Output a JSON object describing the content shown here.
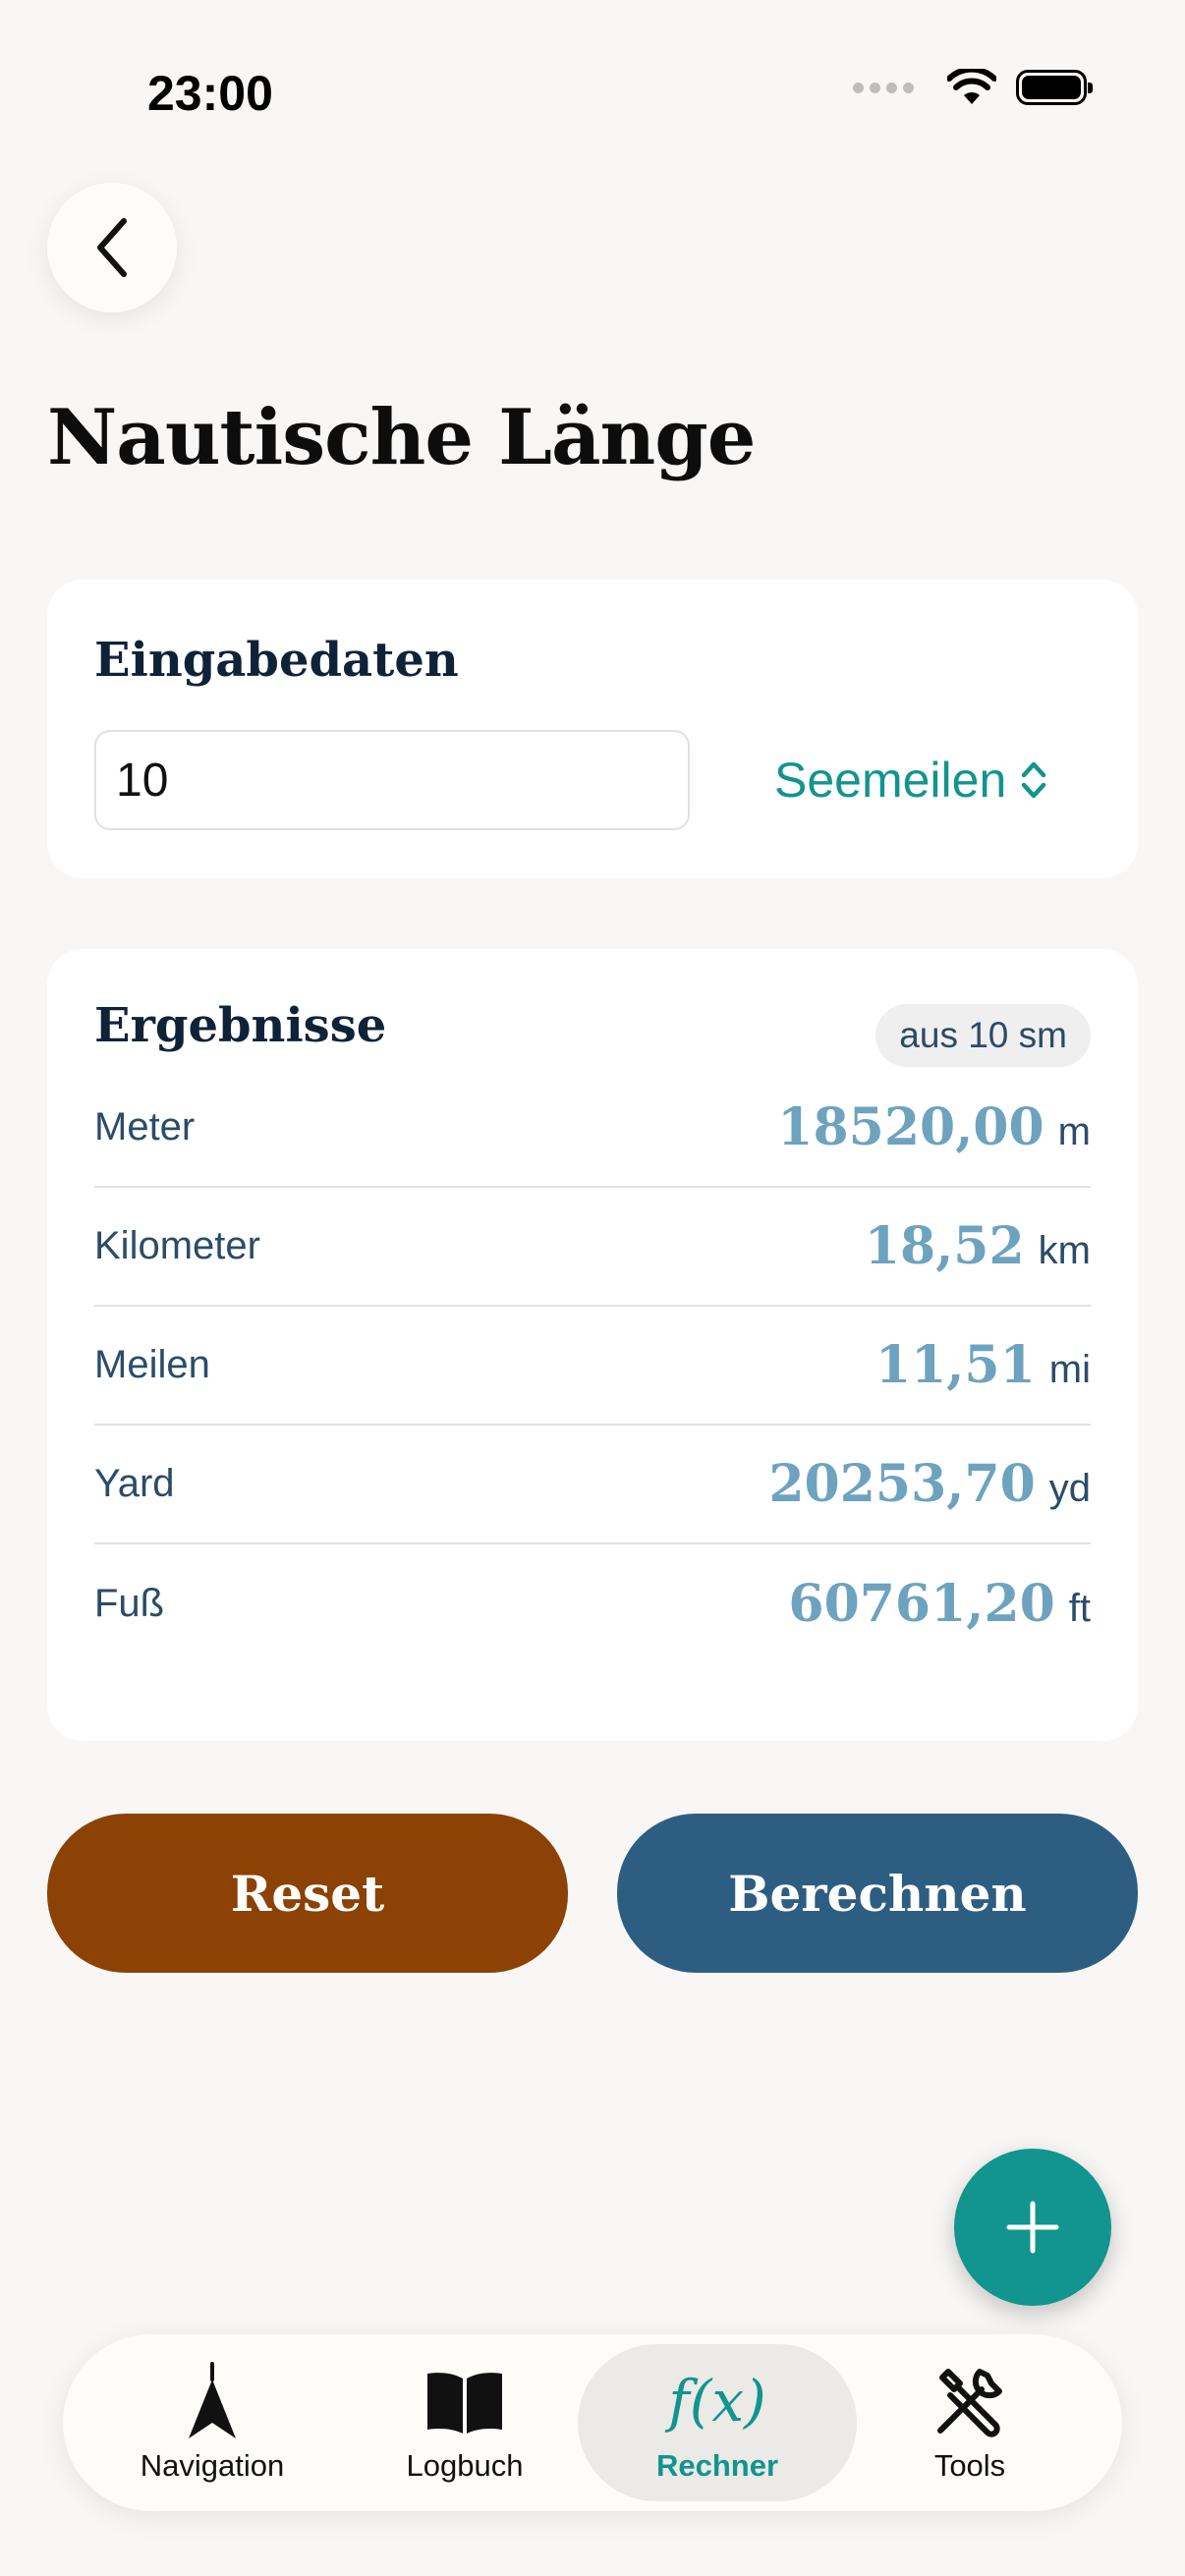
{
  "status_bar": {
    "time": "23:00"
  },
  "header": {
    "title": "Nautische Länge"
  },
  "input_card": {
    "heading": "Eingabedaten",
    "value": "10",
    "unit": "Seemeilen"
  },
  "results_card": {
    "heading": "Ergebnisse",
    "source_chip": "aus 10 sm",
    "rows": [
      {
        "label": "Meter",
        "value": "18520,00",
        "unit": "m"
      },
      {
        "label": "Kilometer",
        "value": "18,52",
        "unit": "km"
      },
      {
        "label": "Meilen",
        "value": "11,51",
        "unit": "mi"
      },
      {
        "label": "Yard",
        "value": "20253,70",
        "unit": "yd"
      },
      {
        "label": "Fuß",
        "value": "60761,20",
        "unit": "ft"
      }
    ]
  },
  "actions": {
    "reset_label": "Reset",
    "calculate_label": "Berechnen"
  },
  "tab_bar": {
    "tabs": [
      {
        "label": "Navigation",
        "icon": "navigation-arrow-icon",
        "active": false
      },
      {
        "label": "Logbuch",
        "icon": "book-icon",
        "active": false
      },
      {
        "label": "Rechner",
        "icon": "function-icon",
        "glyph": "f(x)",
        "active": true
      },
      {
        "label": "Tools",
        "icon": "tools-icon",
        "active": false
      }
    ]
  },
  "colors": {
    "accent": "#12948f",
    "reset_button": "#8b4204",
    "calculate_button": "#2d5e82",
    "result_value": "#6da3bf",
    "background": "#f8f7f5"
  }
}
